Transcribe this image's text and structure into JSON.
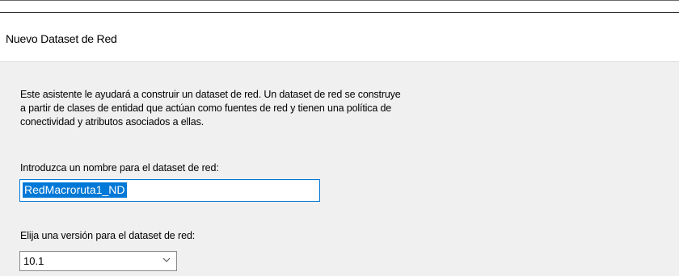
{
  "window": {
    "title": "Nuevo Dataset de Red"
  },
  "intro": {
    "lines": [
      "Este asistente le ayudará a construir un dataset de red. Un dataset de red se construye",
      "a partir de clases de entidad que actúan como fuentes de red y tienen una política de",
      "conectividad y atributos asociados a ellas."
    ]
  },
  "name_field": {
    "label": "Introduzca un nombre para el dataset de red:",
    "value": "RedMacroruta1_ND"
  },
  "version_field": {
    "label": "Elija una versión para el dataset de red:",
    "selected": "10.1",
    "icon": "chevron-down-icon"
  },
  "colors": {
    "selection": "#0078d7",
    "dialog_background": "#f0f0f0",
    "header_background": "#ffffff"
  }
}
